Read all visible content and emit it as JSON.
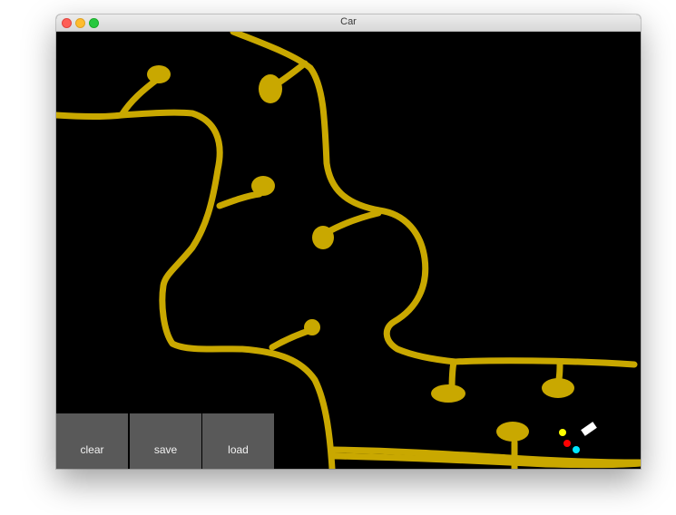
{
  "window": {
    "title": "Car"
  },
  "toolbar": {
    "clear_label": "clear",
    "save_label": "save",
    "load_label": "load"
  },
  "canvas": {
    "background_color": "#000000",
    "track_color": "#c9a800",
    "car": {
      "body_color": "#ffffff",
      "sensor_colors": [
        "#ffff00",
        "#ff0000",
        "#00e5ff"
      ]
    }
  }
}
